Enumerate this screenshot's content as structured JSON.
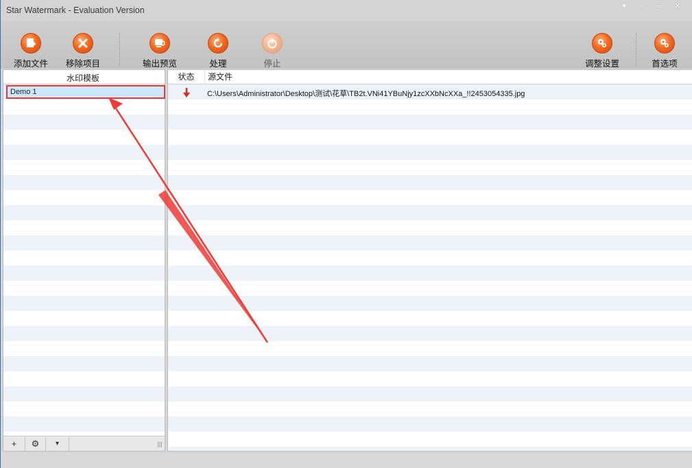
{
  "window": {
    "title": "Star Watermark - Evaluation Version",
    "controls": {
      "dropdown": "▾",
      "minimize": "–",
      "maximize": "▭",
      "close": "✕"
    }
  },
  "toolbar": {
    "add_files": "添加文件",
    "remove_item": "移除项目",
    "output_preview": "输出预览",
    "process": "处理",
    "stop": "停止",
    "adjust_settings": "调整设置",
    "preferences": "首选项"
  },
  "left_panel": {
    "header": "水印模板",
    "items": [
      {
        "label": "Demo 1",
        "selected": true
      }
    ],
    "footer": {
      "add": "+",
      "settings": "⚙",
      "dropdown": "▾",
      "grip": "|||"
    }
  },
  "right_panel": {
    "columns": {
      "status": "状态",
      "source": "源文件"
    },
    "rows": [
      {
        "status_icon": "down-arrow-icon",
        "path": "C:\\Users\\Administrator\\Desktop\\测试\\花草\\TB2t.VNi41YBuNjy1zcXXbNcXXa_!!2453054335.jpg"
      }
    ]
  },
  "colors": {
    "accent_orange": "#f26a22",
    "selection_blue": "#cce6fb",
    "highlight_red": "#e53935",
    "stripe": "#eef3fa"
  }
}
